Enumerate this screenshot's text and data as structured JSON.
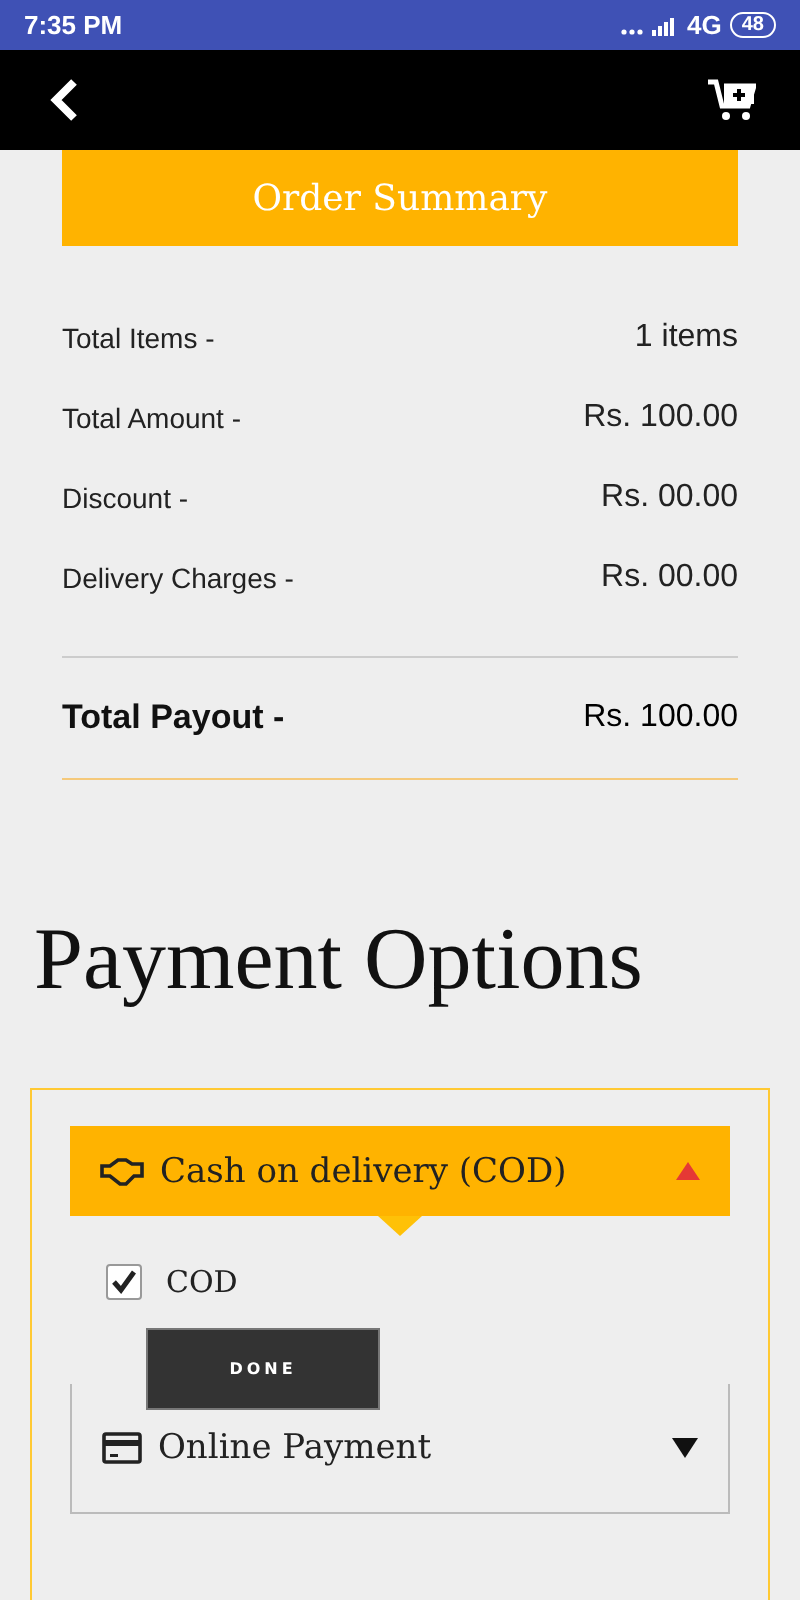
{
  "status_bar": {
    "time": "7:35 PM",
    "network": "4G",
    "battery": "48"
  },
  "order_summary": {
    "title": "Order Summary",
    "rows": [
      {
        "label": "Total Items -",
        "value": "1 items"
      },
      {
        "label": "Total Amount -",
        "value": "Rs. 100.00"
      },
      {
        "label": "Discount -",
        "value": "Rs. 00.00"
      },
      {
        "label": "Delivery Charges -",
        "value": "Rs. 00.00"
      }
    ],
    "total": {
      "label": "Total Payout -",
      "value": "Rs. 100.00"
    }
  },
  "payment": {
    "title": "Payment Options",
    "methods": [
      {
        "kind": "cash",
        "label": "Cash on delivery (COD)",
        "expanded": true,
        "options": [
          {
            "label": "COD",
            "checked": true
          }
        ],
        "button": "DONE"
      },
      {
        "kind": "card",
        "label": "Online Payment",
        "expanded": false
      }
    ]
  }
}
